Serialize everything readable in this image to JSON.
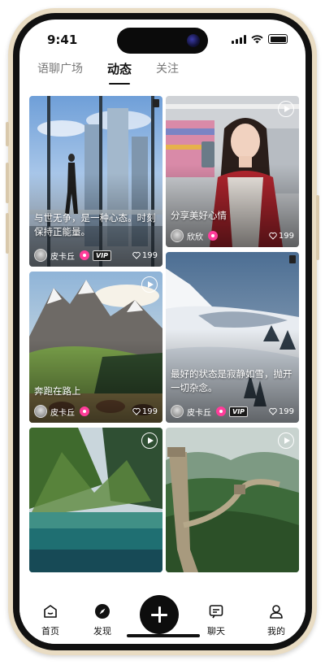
{
  "status": {
    "time": "9:41"
  },
  "tabs": [
    {
      "label": "语聊广场",
      "active": false
    },
    {
      "label": "动态",
      "active": true
    },
    {
      "label": "关注",
      "active": false
    }
  ],
  "feed": [
    {
      "caption": "与世无争，是一种心态。时刻保持正能量。",
      "user": "皮卡丘",
      "vip": "VIP",
      "likes": "199",
      "type": "image"
    },
    {
      "caption": "分享美好心情",
      "user": "欣欣",
      "likes": "199",
      "type": "video"
    },
    {
      "caption": "奔跑在路上",
      "user": "皮卡丘",
      "likes": "199",
      "type": "video"
    },
    {
      "caption": "最好的状态是寂静如雪，抛开一切杂念。",
      "user": "皮卡丘",
      "vip": "VIP",
      "likes": "199",
      "type": "image"
    },
    {
      "type": "video"
    },
    {
      "type": "video"
    }
  ],
  "nav": {
    "home": "首页",
    "discover": "发现",
    "chat": "聊天",
    "mine": "我的"
  },
  "colors": {
    "accent": "#ff3d9a",
    "frame": "#e9dcc3",
    "ink": "#111111"
  }
}
